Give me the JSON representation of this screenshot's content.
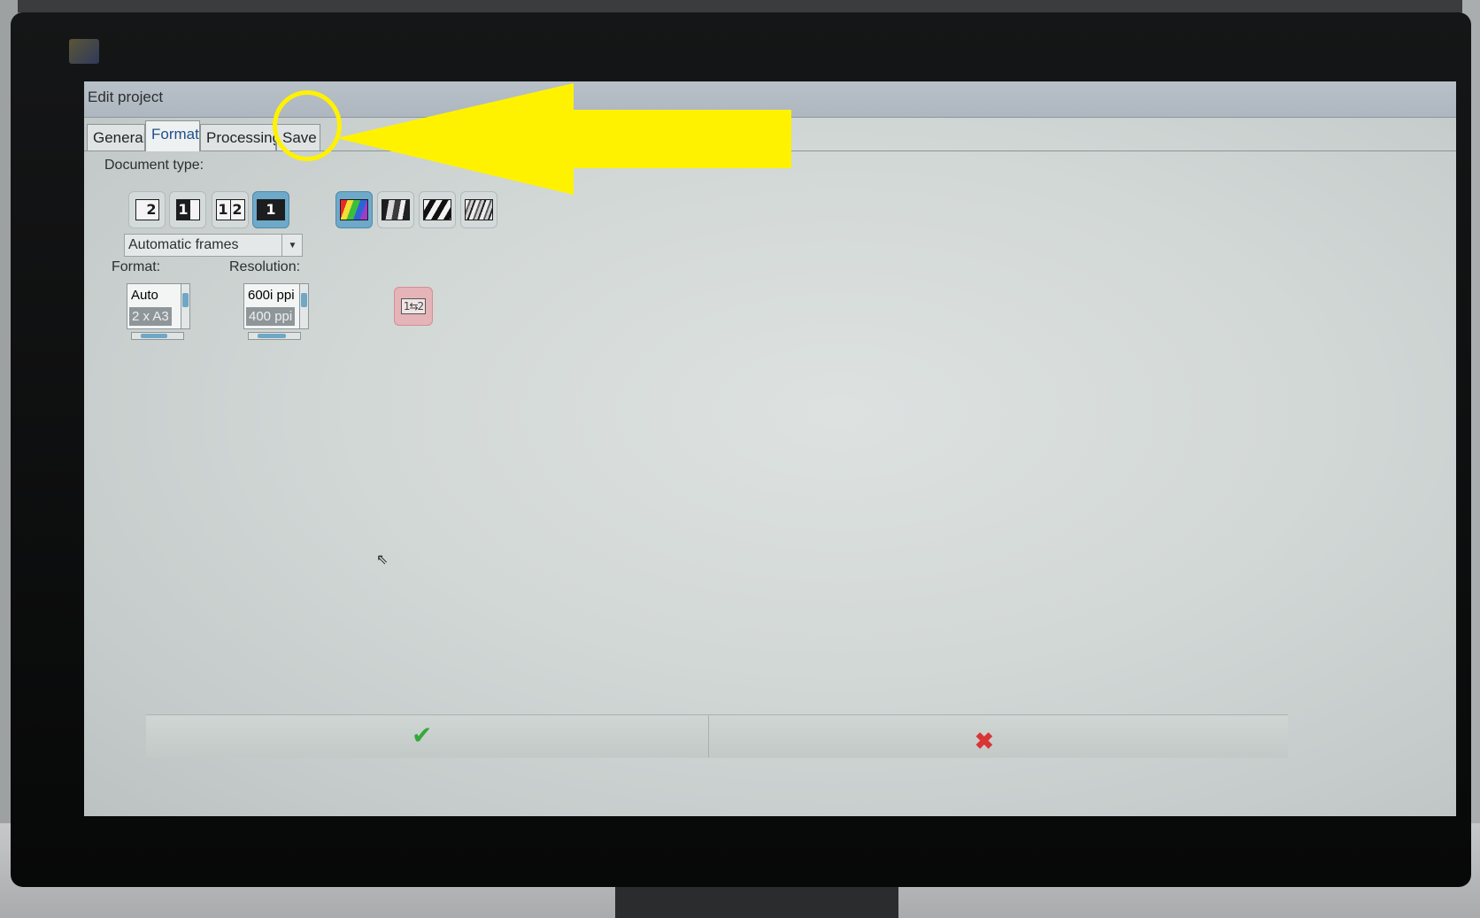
{
  "window": {
    "title": "Edit project"
  },
  "tabs": [
    {
      "label": "General",
      "active": false
    },
    {
      "label": "Format",
      "active": true
    },
    {
      "label": "Processing",
      "active": false
    },
    {
      "label": "Save",
      "active": false
    }
  ],
  "document_type": {
    "label": "Document type:",
    "layout_buttons": [
      {
        "icon": "single-page-2-icon",
        "selected": false
      },
      {
        "icon": "single-page-1-icon",
        "selected": false
      },
      {
        "icon": "two-pages-1-2-icon",
        "selected": false
      },
      {
        "icon": "one-page-dark-icon",
        "selected": true
      }
    ],
    "color_buttons": [
      {
        "icon": "color-mode-icon",
        "selected": true
      },
      {
        "icon": "grayscale-mode-icon",
        "selected": false
      },
      {
        "icon": "black-white-mode-icon",
        "selected": false
      },
      {
        "icon": "mixed-mode-icon",
        "selected": false
      }
    ]
  },
  "frames_dropdown": {
    "value": "Automatic frames"
  },
  "format": {
    "label": "Format:",
    "items": [
      "Auto",
      "2 x A3"
    ],
    "selected_index": 1
  },
  "resolution": {
    "label": "Resolution:",
    "items": [
      "600i ppi",
      "400 ppi"
    ],
    "selected_index": 1
  },
  "pages_button": {
    "icon": "page-order-1-2-icon",
    "text": "1⇆2"
  },
  "footer": {
    "ok_icon": "checkmark-icon",
    "ok_glyph": "✔",
    "ok_color": "#35a83a",
    "cancel_icon": "cross-icon",
    "cancel_glyph": "✖",
    "cancel_color": "#d93535"
  },
  "annotation": {
    "color": "#fff200"
  }
}
